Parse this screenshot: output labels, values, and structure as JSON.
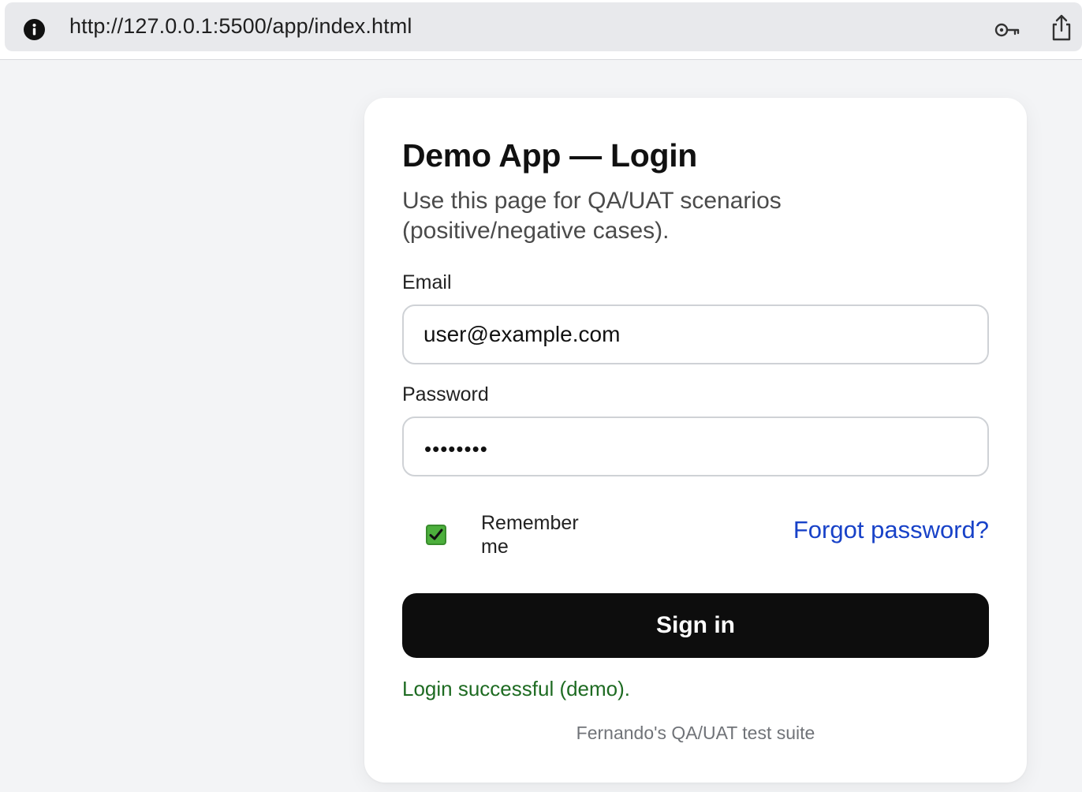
{
  "browser": {
    "url": "http://127.0.0.1:5500/app/index.html",
    "icons": {
      "site_info": "info-icon",
      "passwords": "key-icon",
      "share": "share-icon"
    }
  },
  "login": {
    "title": "Demo App — Login",
    "subtitle": "Use this page for QA/UAT scenarios (positive/negative cases).",
    "email_label": "Email",
    "email_value": "user@example.com",
    "password_label": "Password",
    "password_masked": "••••••••",
    "remember_label": "Remember me",
    "remember_checked": true,
    "forgot_label": "Forgot password?",
    "submit_label": "Sign in",
    "status_message": "Login successful (demo).",
    "footer": "Fernando's QA/UAT test suite"
  },
  "colors": {
    "page_background": "#f3f4f6",
    "button": "#0d0d0d",
    "link": "#1842c8",
    "success": "#1e6b22",
    "checkbox": "#4caf3c"
  }
}
